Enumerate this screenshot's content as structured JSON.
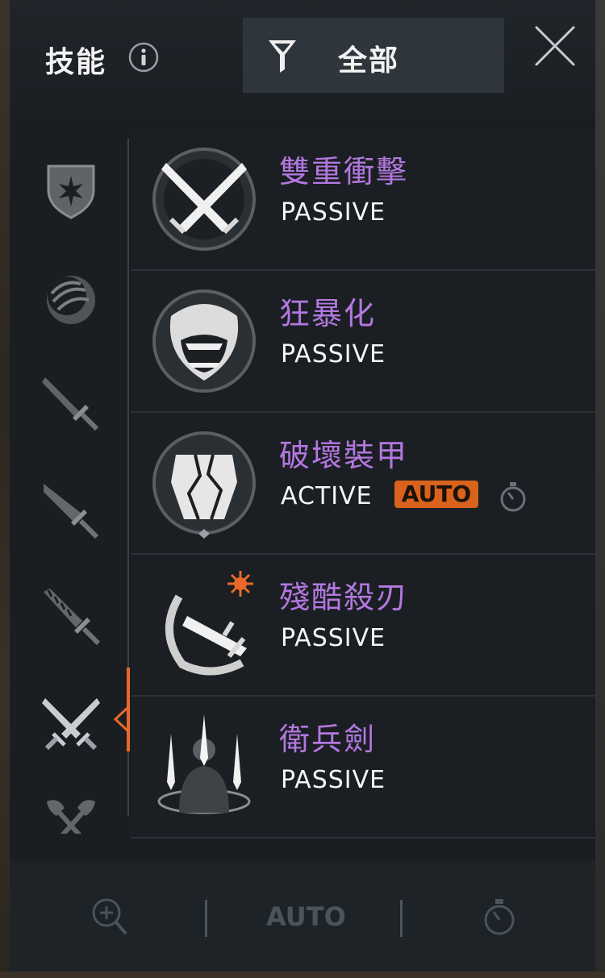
{
  "header": {
    "title": "技能",
    "filter_label": "全部"
  },
  "categories": [
    {
      "id": "shield"
    },
    {
      "id": "orb"
    },
    {
      "id": "sword-1"
    },
    {
      "id": "sword-2"
    },
    {
      "id": "sword-3"
    },
    {
      "id": "crossed-swords",
      "active": true
    },
    {
      "id": "axes"
    }
  ],
  "skills": [
    {
      "name": "雙重衝擊",
      "type": "PASSIVE",
      "auto": false
    },
    {
      "name": "狂暴化",
      "type": "PASSIVE",
      "auto": false
    },
    {
      "name": "破壞裝甲",
      "type": "ACTIVE",
      "auto": true,
      "auto_label": "AUTO"
    },
    {
      "name": "殘酷殺刃",
      "type": "PASSIVE",
      "auto": false
    },
    {
      "name": "衛兵劍",
      "type": "PASSIVE",
      "auto": false
    }
  ],
  "bottom_bar": {
    "auto_label": "AUTO"
  },
  "colors": {
    "skill_name": "#b378e0",
    "accent": "#e8692a",
    "panel": "#1a1e22"
  }
}
